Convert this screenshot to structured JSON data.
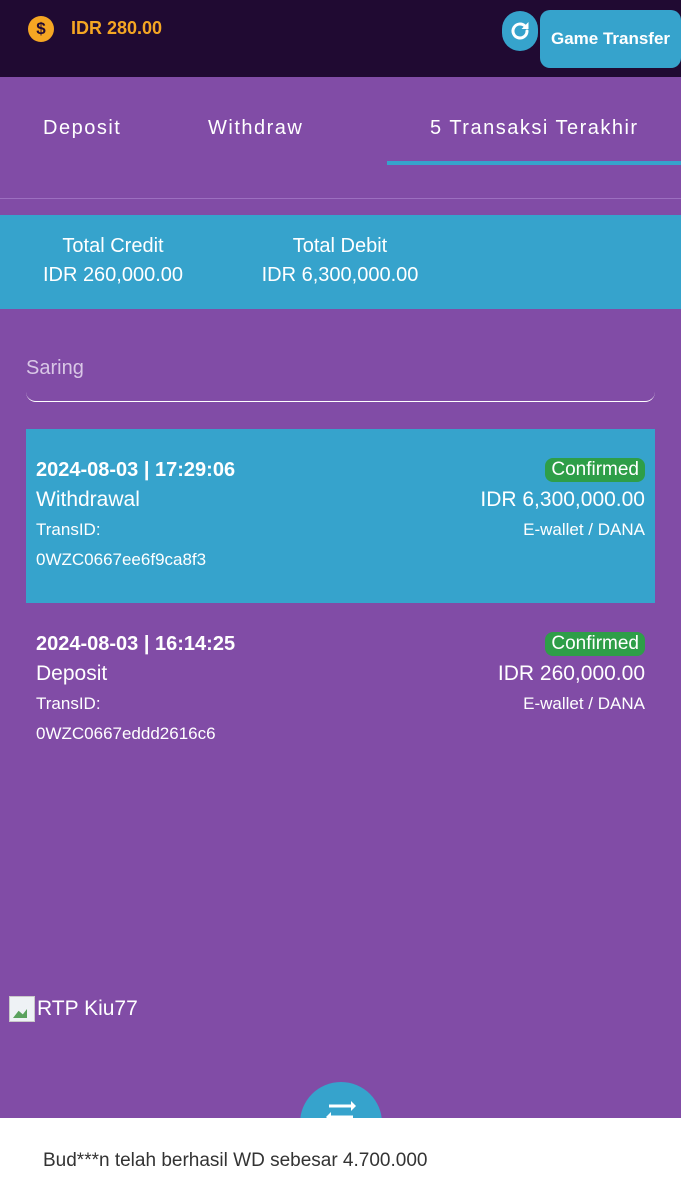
{
  "header": {
    "balance": "IDR 280.00",
    "coin_symbol": "$",
    "game_transfer_label": "Game Transfer"
  },
  "tabs": [
    {
      "label": "Deposit",
      "active": false
    },
    {
      "label": "Withdraw",
      "active": false
    },
    {
      "label": "5 Transaksi Terakhir",
      "active": true
    }
  ],
  "summary": {
    "credit_label": "Total Credit",
    "credit_value": "IDR 260,000.00",
    "debit_label": "Total Debit",
    "debit_value": "IDR 6,300,000.00"
  },
  "filter": {
    "placeholder": "Saring",
    "value": ""
  },
  "transactions": [
    {
      "datetime": "2024-08-03 | 17:29:06",
      "type": "Withdrawal",
      "trans_label": "TransID:",
      "trans_id": "0WZC0667ee6f9ca8f3",
      "status": "Confirmed",
      "amount": "IDR 6,300,000.00",
      "method": "E-wallet / DANA"
    },
    {
      "datetime": "2024-08-03 | 16:14:25",
      "type": "Deposit",
      "trans_label": "TransID:",
      "trans_id": "0WZC0667eddd2616c6",
      "status": "Confirmed",
      "amount": "IDR 260,000.00",
      "method": "E-wallet / DANA"
    }
  ],
  "rtp_image": {
    "alt": "RTP Kiu77"
  },
  "ticker": {
    "text": "Bud***n telah berhasil WD sebesar 4.700.000"
  },
  "colors": {
    "background": "#814ca6",
    "header": "#200a32",
    "accent": "#36a3cc",
    "gold": "#f5a623",
    "confirmed": "#2e9e48"
  }
}
